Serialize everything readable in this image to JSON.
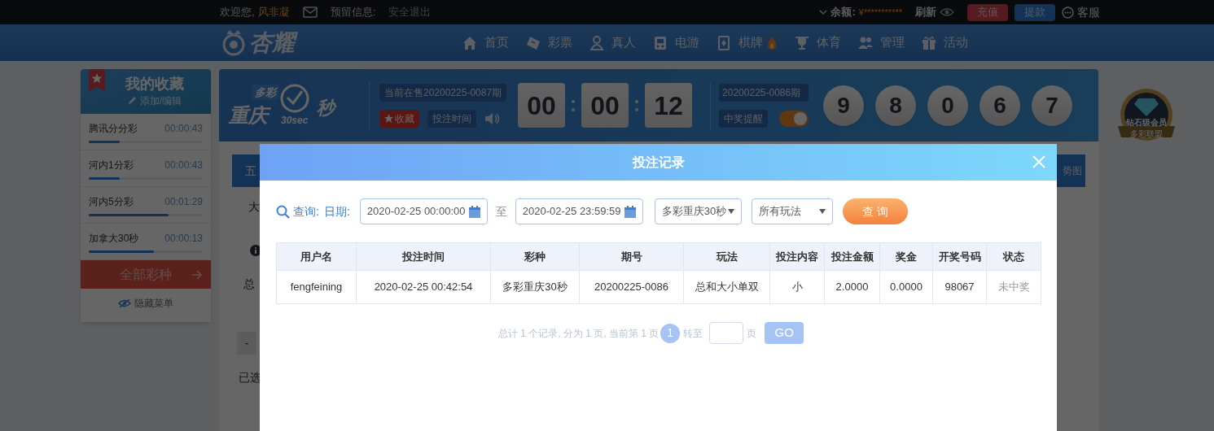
{
  "top_bar": {
    "greeting": "欢迎您,",
    "username": "风非凝",
    "reserved_label": "预留信息:",
    "logout": "安全退出",
    "balance_label": "余额:",
    "balance": "¥***********",
    "refresh": "刷新",
    "deposit": "充值",
    "withdraw": "提款",
    "service": "客服"
  },
  "nav": {
    "logo": "杏耀",
    "items": [
      {
        "label": "首页",
        "kind": "home"
      },
      {
        "label": "彩票",
        "kind": "ticket"
      },
      {
        "label": "真人",
        "kind": "person"
      },
      {
        "label": "电游",
        "kind": "arcade"
      },
      {
        "label": "棋牌",
        "kind": "card"
      },
      {
        "label": "体育",
        "kind": "trophy"
      },
      {
        "label": "管理",
        "kind": "users"
      },
      {
        "label": "活动",
        "kind": "gift"
      }
    ]
  },
  "favorites": {
    "title": "我的收藏",
    "edit": "添加/编辑",
    "items": [
      {
        "name": "腾讯分分彩",
        "time": "00:00:43",
        "level": 0.27
      },
      {
        "name": "河内1分彩",
        "time": "00:00:43",
        "level": 0.27
      },
      {
        "name": "河内5分彩",
        "time": "00:01:29",
        "level": 0.7
      },
      {
        "name": "加拿大30秒",
        "time": "00:00:13",
        "level": 0.57
      }
    ],
    "all_button": "全部彩种",
    "hide_menu": "隐藏菜单"
  },
  "game": {
    "logo_top": "多彩",
    "logo_main": "重庆",
    "logo_sub": "30sec",
    "logo_sec": "秒",
    "current_issue": "当前在售20200225-0087期",
    "favorite": "收藏",
    "bet_time": "投注时间",
    "countdown": [
      "00",
      "00",
      "12"
    ],
    "last_issue": "20200225-0086期",
    "win_alert": "中奖提醒",
    "win_alert_on": true,
    "numbers": [
      "9",
      "8",
      "0",
      "6",
      "7"
    ]
  },
  "badge": {
    "title": "钻石级会员",
    "subtitle": "多彩联盟"
  },
  "background_fragments": {
    "left": [
      "五",
      "大",
      "总",
      "-",
      "已选"
    ],
    "right": "势图"
  },
  "dialog": {
    "title": "投注记录",
    "query_label": "查询:",
    "date_label": "日期:",
    "start_date": "2020-02-25 00:00:00",
    "to": "至",
    "end_date": "2020-02-25 23:59:59",
    "lottery": "多彩重庆30秒",
    "play": "所有玩法",
    "search_button": "查 询",
    "table": {
      "columns": [
        "用户名",
        "投注时间",
        "彩种",
        "期号",
        "玩法",
        "投注内容",
        "投注金额",
        "奖金",
        "开奖号码",
        "状态"
      ],
      "rows": [
        [
          "fengfeining",
          "2020-02-25 00:42:54",
          "多彩重庆30秒",
          "20200225-0086",
          "总和大小单双",
          "小",
          "2.0000",
          "0.0000",
          "98067",
          "未中奖"
        ]
      ]
    },
    "pagination": {
      "summary": "总计 1 个记录, 分为 1 页, 当前第 1 页",
      "pages": [
        {
          "label": "1",
          "selected": true
        }
      ],
      "goto": "转至",
      "page_unit": "页",
      "go": "GO"
    }
  }
}
